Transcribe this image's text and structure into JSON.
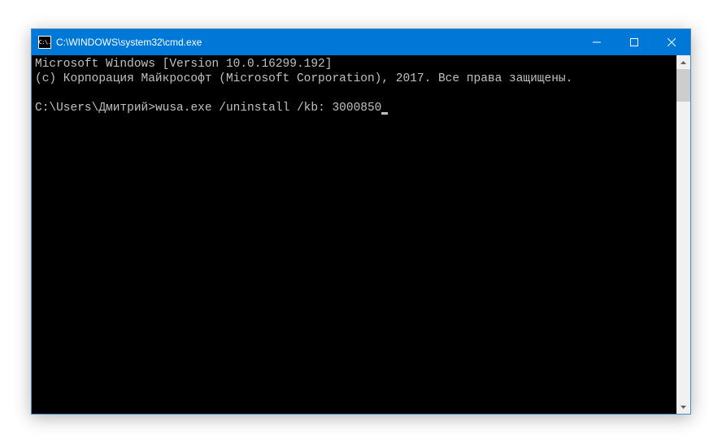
{
  "window": {
    "title": "C:\\WINDOWS\\system32\\cmd.exe",
    "icon_text": "C:\\."
  },
  "console": {
    "line1": "Microsoft Windows [Version 10.0.16299.192]",
    "line2": "(c) Корпорация Майкрософт (Microsoft Corporation), 2017. Все права защищены.",
    "blank": "",
    "prompt": "C:\\Users\\Дмитрий>",
    "command": "wusa.exe /uninstall /kb: 3000850"
  }
}
